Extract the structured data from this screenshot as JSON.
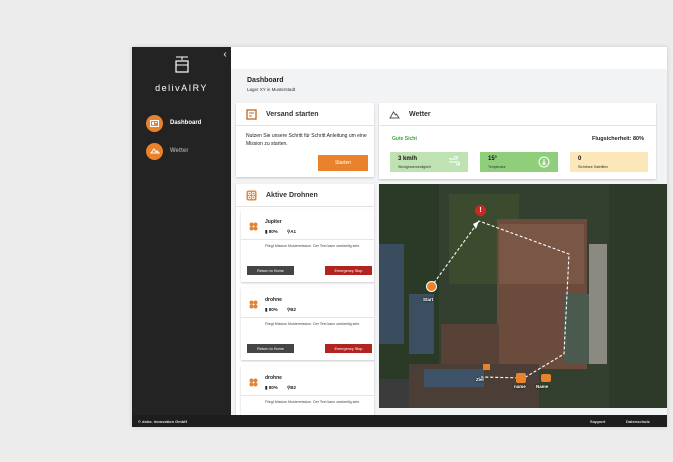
{
  "brand": {
    "logo_text": "delivAIRY"
  },
  "nav": [
    {
      "label": "Dashboard",
      "icon": "dashboard-icon"
    },
    {
      "label": "Wetter",
      "icon": "weather-icon"
    }
  ],
  "header": {
    "title": "Dashboard",
    "subtitle": "Lager XY in Musterstadt"
  },
  "versand": {
    "title": "Versand starten",
    "text": "Nutzen Sie unsere Schritt für Schritt Anleitung um eine Mission zu starten.",
    "button": "Starten"
  },
  "wetter": {
    "title": "Wetter",
    "status": "Gute Sicht",
    "safety": "Flugsicherheit: 80%",
    "tiles": [
      {
        "value": "3 km/h",
        "label": "Windgeschwindigkeit",
        "color": "#bfe2b2",
        "icon": "wind-icon"
      },
      {
        "value": "15°",
        "label": "Temperatur",
        "color": "#8fcf7c",
        "icon": "thermometer-icon"
      },
      {
        "value": "0",
        "label": "Sichtbare Satelliten",
        "color": "#fbe7b8",
        "icon": ""
      }
    ]
  },
  "drohnen": {
    "title": "Aktive Drohnen",
    "items": [
      {
        "name": "Jupiter",
        "battery": "80%",
        "position": "A1",
        "desc": "Fliegt Mission Mustermission. Der Text kann zweizeilig sein.",
        "btn_home": "Return to Home",
        "btn_stop": "Emergency Stop"
      },
      {
        "name": "drohne",
        "battery": "80%",
        "position": "B2",
        "desc": "Fliegt Mission Mustermission. Der Text kann zweizeilig sein.",
        "btn_home": "Return to Home",
        "btn_stop": "Emergency Stop"
      },
      {
        "name": "drohne",
        "battery": "80%",
        "position": "B2",
        "desc": "Fliegt Mission Mustermission. Der Text kann zweizeilig sein.",
        "btn_home": "",
        "btn_stop": ""
      }
    ]
  },
  "map": {
    "start": "Start",
    "ziel": "Ziel",
    "marker1": "name",
    "marker2": "Name"
  },
  "footer": {
    "copyright": "© dobs. innovation GmbH",
    "support": "Support",
    "datenschutz": "Datenschutz"
  },
  "colors": {
    "accent": "#e9822c",
    "danger": "#b2241f",
    "sidebar": "#232323"
  }
}
